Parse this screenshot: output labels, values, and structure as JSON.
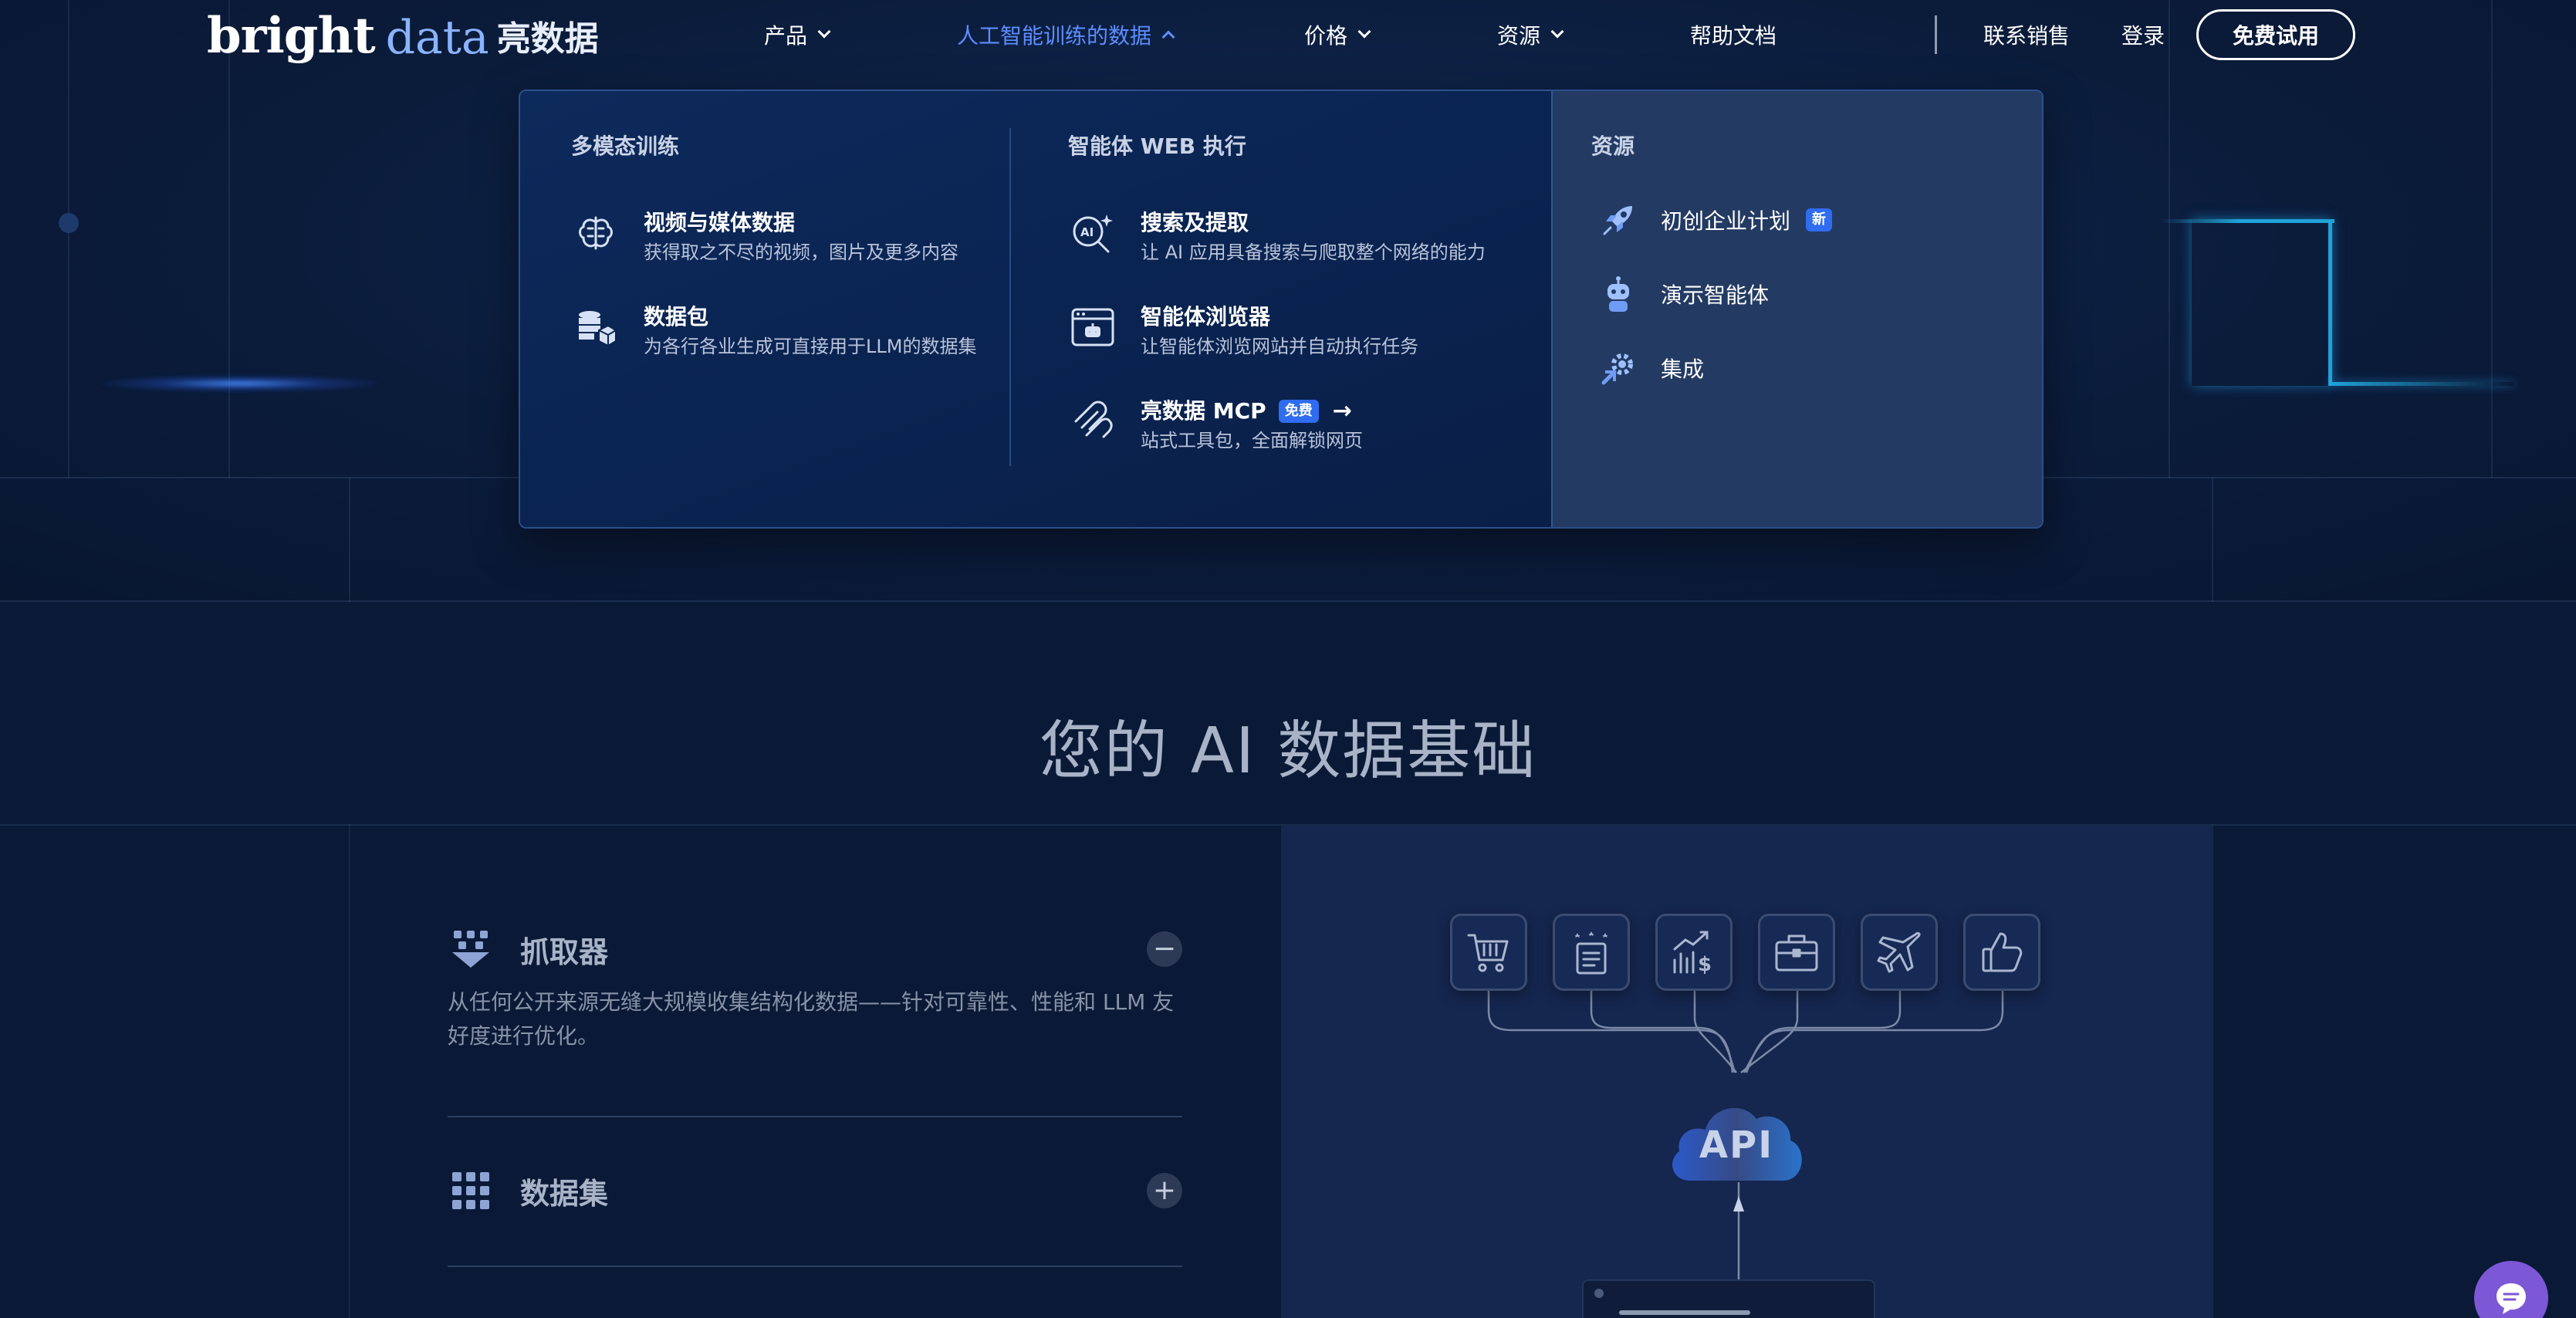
{
  "brand": {
    "bright": "bright",
    "data": "data",
    "cn": "亮数据"
  },
  "nav": {
    "products": "产品",
    "ai_training_data": "人工智能训练的数据",
    "pricing": "价格",
    "resources": "资源",
    "docs": "帮助文档",
    "contact_sales": "联系销售",
    "login": "登录",
    "free_trial": "免费试用"
  },
  "dropdown": {
    "col1": {
      "heading": "多模态训练",
      "items": [
        {
          "title": "视频与媒体数据",
          "desc": "获得取之不尽的视频，图片及更多内容",
          "icon": "brain-icon"
        },
        {
          "title": "数据包",
          "desc": "为各行各业生成可直接用于LLM的数据集",
          "icon": "database-package-icon"
        }
      ]
    },
    "col2": {
      "heading": "智能体 WEB 执行",
      "items": [
        {
          "title": "搜索及提取",
          "desc": "让 AI 应用具备搜索与爬取整个网络的能力",
          "icon": "ai-search-icon"
        },
        {
          "title": "智能体浏览器",
          "desc": "让智能体浏览网站并自动执行任务",
          "icon": "agent-browser-icon"
        },
        {
          "title": "亮数据 MCP",
          "badge": "免费",
          "arrow": "→",
          "desc": "站式工具包，全面解锁网页",
          "icon": "mcp-icon"
        }
      ]
    },
    "side": {
      "heading": "资源",
      "items": [
        {
          "title": "初创企业计划",
          "badge": "新",
          "icon": "rocket-icon"
        },
        {
          "title": "演示智能体",
          "icon": "robot-icon"
        },
        {
          "title": "集成",
          "icon": "integration-gear-icon"
        }
      ]
    }
  },
  "section": {
    "title": "您的 AI 数据基础"
  },
  "accordion": [
    {
      "title": "抓取器",
      "toggle": "−",
      "desc": "从任何公开来源无缝大规模收集结构化数据——针对可靠性、性能和 LLM 友好度进行优化。",
      "icon": "scraper-icon"
    },
    {
      "title": "数据集",
      "toggle": "+",
      "icon": "dataset-grid-icon"
    }
  ],
  "illustration": {
    "api_label": "API",
    "tiles": [
      "cart-icon",
      "review-card-icon",
      "pricing-chart-icon",
      "briefcase-icon",
      "airplane-icon",
      "thumbs-up-icon"
    ]
  },
  "colors": {
    "background": "#0a1a36",
    "accent": "#5d8dff",
    "badge": "#2f6cf0",
    "dropdown_side": "#233a63",
    "chat": "#7c57d6"
  }
}
